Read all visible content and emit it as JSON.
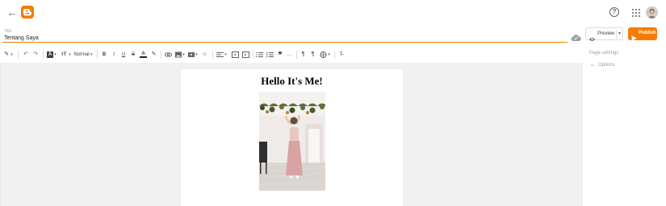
{
  "header": {
    "back_icon": "arrow-left-icon",
    "logo_icon": "blogger-logo-icon",
    "help_icon": "help-circle-icon",
    "apps_icon": "apps-grid-icon",
    "avatar_icon": "user-avatar"
  },
  "post": {
    "title_label": "Title",
    "title_value": "Tentang Saya"
  },
  "actions": {
    "preview_label": "Preview",
    "publish_label": "Publish",
    "colors": {
      "accent": "#f57c00"
    }
  },
  "toolbar": {
    "format_label": "Normal",
    "bold": "B",
    "italic": "I",
    "underline": "U",
    "strike": "S",
    "text_color": "A",
    "quote": "❞",
    "more": "…"
  },
  "sidebar": {
    "page_settings_label": "Page settings",
    "options_label": "Options"
  },
  "content": {
    "heading": "Hello It's Me!"
  }
}
